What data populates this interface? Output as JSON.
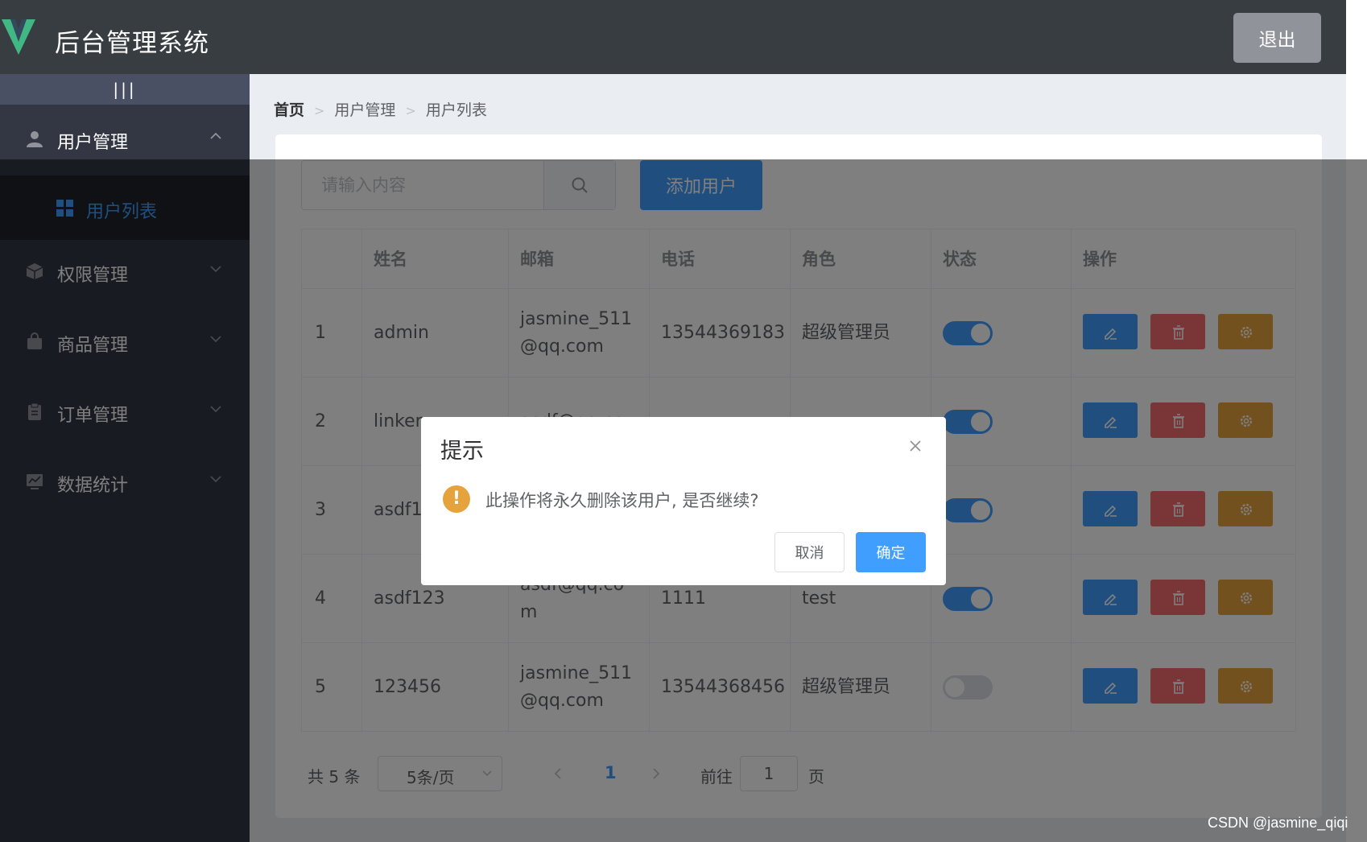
{
  "header": {
    "title": "后台管理系统",
    "logout_label": "退出",
    "logo_icon": "vue-logo-icon"
  },
  "sidebar": {
    "collapse_label": "|||",
    "menus": [
      {
        "label": "用户管理",
        "icon": "user-icon",
        "expanded": true
      },
      {
        "label": "权限管理",
        "icon": "box-icon",
        "expanded": false
      },
      {
        "label": "商品管理",
        "icon": "bag-icon",
        "expanded": false
      },
      {
        "label": "订单管理",
        "icon": "clipboard-icon",
        "expanded": false
      },
      {
        "label": "数据统计",
        "icon": "chart-icon",
        "expanded": false
      }
    ],
    "submenu": {
      "label": "用户列表",
      "icon": "grid-icon",
      "active": true
    }
  },
  "breadcrumb": {
    "home": "首页",
    "level1": "用户管理",
    "level2": "用户列表"
  },
  "toolbar": {
    "search_placeholder": "请输入内容",
    "search_icon": "search-icon",
    "add_label": "添加用户"
  },
  "table": {
    "columns": [
      "",
      "姓名",
      "邮箱",
      "电话",
      "角色",
      "状态",
      "操作"
    ],
    "rows": [
      {
        "index": "1",
        "name": "admin",
        "email": "jasmine_511@qq.com",
        "phone": "13544369183",
        "role": "超级管理员",
        "status": true
      },
      {
        "index": "2",
        "name": "linker",
        "email": "asdf@qq.co",
        "phone": "",
        "role": "",
        "status": true
      },
      {
        "index": "3",
        "name": "asdf1",
        "email": "",
        "phone": "",
        "role": "",
        "status": true
      },
      {
        "index": "4",
        "name": "asdf123",
        "email": "asdf@qq.com",
        "phone": "1111",
        "role": "test",
        "status": true
      },
      {
        "index": "5",
        "name": "123456",
        "email": "jasmine_511@qq.com",
        "phone": "13544368456",
        "role": "超级管理员",
        "status": false
      }
    ],
    "action_icons": [
      "edit-icon",
      "delete-icon",
      "settings-icon"
    ]
  },
  "pagination": {
    "total": "共 5 条",
    "page_size": "5条/页",
    "current": "1",
    "goto": "前往",
    "goto_value": "1",
    "unit": "页"
  },
  "dialog": {
    "title": "提示",
    "warn_symbol": "!",
    "message": "此操作将永久删除该用户, 是否继续?",
    "cancel_label": "取消",
    "ok_label": "确定"
  },
  "watermark": "CSDN @jasmine_qiqi",
  "colors": {
    "primary": "#409eff",
    "danger": "#f56c6c",
    "warning": "#e6a23c",
    "header_bg": "#373d41",
    "sidebar_bg": "#333744"
  }
}
